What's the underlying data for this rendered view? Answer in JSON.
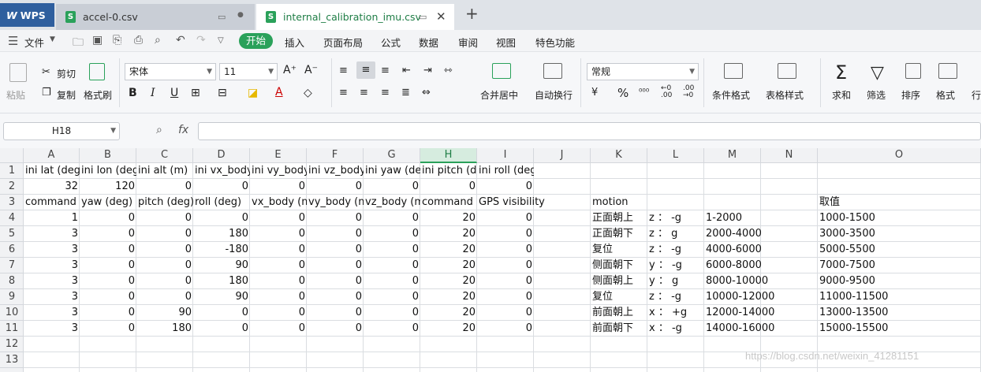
{
  "tabs": {
    "wps": "WPS",
    "file1": "accel-0.csv",
    "file2": "internal_calibration_imu.csv",
    "new_tab": "+"
  },
  "menu": {
    "file": "文件",
    "start": "开始",
    "items": [
      "插入",
      "页面布局",
      "公式",
      "数据",
      "审阅",
      "视图",
      "特色功能"
    ]
  },
  "ribbon": {
    "paste": "粘贴",
    "cut": "剪切",
    "copy": "复制",
    "format_painter": "格式刷",
    "font_name": "宋体",
    "font_size": "11",
    "bold": "B",
    "italic": "I",
    "underline": "U",
    "merge_center": "合并居中",
    "wrap_text": "自动换行",
    "number_format": "常规",
    "percent": "%",
    "conditional_format": "条件格式",
    "table_style": "表格样式",
    "sum": "求和",
    "filter": "筛选",
    "sort": "排序",
    "format": "格式",
    "row_col": "行"
  },
  "formula_bar": {
    "name_box": "H18",
    "fx": "fx",
    "value": ""
  },
  "columns": [
    "A",
    "B",
    "C",
    "D",
    "E",
    "F",
    "G",
    "H",
    "I",
    "J",
    "K",
    "L",
    "M",
    "N",
    "O"
  ],
  "selected_column": "H",
  "rows": [
    "1",
    "2",
    "3",
    "4",
    "5",
    "6",
    "7",
    "8",
    "9",
    "10",
    "11",
    "12",
    "13"
  ],
  "cells": {
    "r1": [
      "ini lat (deg)",
      "ini lon (deg)",
      "ini alt (m)",
      "ini vx_body",
      "ini vy_body",
      "ini vz_body",
      "ini yaw (deg)",
      "ini pitch (deg)",
      "ini roll (deg)"
    ],
    "r2": [
      "32",
      "120",
      "0",
      "0",
      "0",
      "0",
      "0",
      "0",
      "0"
    ],
    "r3": [
      "command",
      "yaw (deg)",
      "pitch (deg)",
      "roll (deg)",
      "vx_body (m",
      "vy_body (m",
      "vz_body (m",
      "command",
      "GPS visibility"
    ],
    "r3_extra": {
      "K": "motion",
      "O": "取值"
    },
    "data": [
      [
        "1",
        "0",
        "0",
        "0",
        "0",
        "0",
        "0",
        "20",
        "0",
        "正面朝上",
        "z ： -g",
        "1-2000",
        "1000-1500"
      ],
      [
        "3",
        "0",
        "0",
        "180",
        "0",
        "0",
        "0",
        "20",
        "0",
        "正面朝下",
        "z ： g",
        "2000-4000",
        "3000-3500"
      ],
      [
        "3",
        "0",
        "0",
        "-180",
        "0",
        "0",
        "0",
        "20",
        "0",
        "复位",
        "z ： -g",
        "4000-6000",
        "5000-5500"
      ],
      [
        "3",
        "0",
        "0",
        "90",
        "0",
        "0",
        "0",
        "20",
        "0",
        "侧面朝下",
        "y ： -g",
        "6000-8000",
        "7000-7500"
      ],
      [
        "3",
        "0",
        "0",
        "180",
        "0",
        "0",
        "0",
        "20",
        "0",
        "侧面朝上",
        "y ： g",
        "8000-10000",
        "9000-9500"
      ],
      [
        "3",
        "0",
        "0",
        "90",
        "0",
        "0",
        "0",
        "20",
        "0",
        "复位",
        "z ： -g",
        "10000-12000",
        "11000-11500"
      ],
      [
        "3",
        "0",
        "90",
        "0",
        "0",
        "0",
        "0",
        "20",
        "0",
        "前面朝上",
        "x ： +g",
        "12000-14000",
        "13000-13500"
      ],
      [
        "3",
        "0",
        "180",
        "0",
        "0",
        "0",
        "0",
        "20",
        "0",
        "前面朝下",
        "x ： -g",
        "14000-16000",
        "15000-15500"
      ]
    ]
  },
  "watermark": "https://blog.csdn.net/weixin_41281151",
  "colors": {
    "accent": "#2aa15a",
    "wps_tab": "#2f5f9e"
  }
}
